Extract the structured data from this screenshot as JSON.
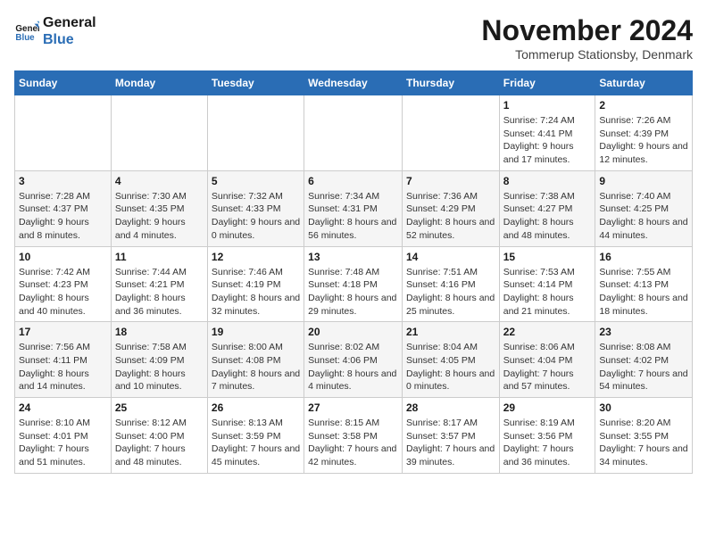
{
  "logo": {
    "line1": "General",
    "line2": "Blue"
  },
  "title": "November 2024",
  "location": "Tommerup Stationsby, Denmark",
  "weekdays": [
    "Sunday",
    "Monday",
    "Tuesday",
    "Wednesday",
    "Thursday",
    "Friday",
    "Saturday"
  ],
  "weeks": [
    [
      {
        "day": "",
        "info": ""
      },
      {
        "day": "",
        "info": ""
      },
      {
        "day": "",
        "info": ""
      },
      {
        "day": "",
        "info": ""
      },
      {
        "day": "",
        "info": ""
      },
      {
        "day": "1",
        "info": "Sunrise: 7:24 AM\nSunset: 4:41 PM\nDaylight: 9 hours and 17 minutes."
      },
      {
        "day": "2",
        "info": "Sunrise: 7:26 AM\nSunset: 4:39 PM\nDaylight: 9 hours and 12 minutes."
      }
    ],
    [
      {
        "day": "3",
        "info": "Sunrise: 7:28 AM\nSunset: 4:37 PM\nDaylight: 9 hours and 8 minutes."
      },
      {
        "day": "4",
        "info": "Sunrise: 7:30 AM\nSunset: 4:35 PM\nDaylight: 9 hours and 4 minutes."
      },
      {
        "day": "5",
        "info": "Sunrise: 7:32 AM\nSunset: 4:33 PM\nDaylight: 9 hours and 0 minutes."
      },
      {
        "day": "6",
        "info": "Sunrise: 7:34 AM\nSunset: 4:31 PM\nDaylight: 8 hours and 56 minutes."
      },
      {
        "day": "7",
        "info": "Sunrise: 7:36 AM\nSunset: 4:29 PM\nDaylight: 8 hours and 52 minutes."
      },
      {
        "day": "8",
        "info": "Sunrise: 7:38 AM\nSunset: 4:27 PM\nDaylight: 8 hours and 48 minutes."
      },
      {
        "day": "9",
        "info": "Sunrise: 7:40 AM\nSunset: 4:25 PM\nDaylight: 8 hours and 44 minutes."
      }
    ],
    [
      {
        "day": "10",
        "info": "Sunrise: 7:42 AM\nSunset: 4:23 PM\nDaylight: 8 hours and 40 minutes."
      },
      {
        "day": "11",
        "info": "Sunrise: 7:44 AM\nSunset: 4:21 PM\nDaylight: 8 hours and 36 minutes."
      },
      {
        "day": "12",
        "info": "Sunrise: 7:46 AM\nSunset: 4:19 PM\nDaylight: 8 hours and 32 minutes."
      },
      {
        "day": "13",
        "info": "Sunrise: 7:48 AM\nSunset: 4:18 PM\nDaylight: 8 hours and 29 minutes."
      },
      {
        "day": "14",
        "info": "Sunrise: 7:51 AM\nSunset: 4:16 PM\nDaylight: 8 hours and 25 minutes."
      },
      {
        "day": "15",
        "info": "Sunrise: 7:53 AM\nSunset: 4:14 PM\nDaylight: 8 hours and 21 minutes."
      },
      {
        "day": "16",
        "info": "Sunrise: 7:55 AM\nSunset: 4:13 PM\nDaylight: 8 hours and 18 minutes."
      }
    ],
    [
      {
        "day": "17",
        "info": "Sunrise: 7:56 AM\nSunset: 4:11 PM\nDaylight: 8 hours and 14 minutes."
      },
      {
        "day": "18",
        "info": "Sunrise: 7:58 AM\nSunset: 4:09 PM\nDaylight: 8 hours and 10 minutes."
      },
      {
        "day": "19",
        "info": "Sunrise: 8:00 AM\nSunset: 4:08 PM\nDaylight: 8 hours and 7 minutes."
      },
      {
        "day": "20",
        "info": "Sunrise: 8:02 AM\nSunset: 4:06 PM\nDaylight: 8 hours and 4 minutes."
      },
      {
        "day": "21",
        "info": "Sunrise: 8:04 AM\nSunset: 4:05 PM\nDaylight: 8 hours and 0 minutes."
      },
      {
        "day": "22",
        "info": "Sunrise: 8:06 AM\nSunset: 4:04 PM\nDaylight: 7 hours and 57 minutes."
      },
      {
        "day": "23",
        "info": "Sunrise: 8:08 AM\nSunset: 4:02 PM\nDaylight: 7 hours and 54 minutes."
      }
    ],
    [
      {
        "day": "24",
        "info": "Sunrise: 8:10 AM\nSunset: 4:01 PM\nDaylight: 7 hours and 51 minutes."
      },
      {
        "day": "25",
        "info": "Sunrise: 8:12 AM\nSunset: 4:00 PM\nDaylight: 7 hours and 48 minutes."
      },
      {
        "day": "26",
        "info": "Sunrise: 8:13 AM\nSunset: 3:59 PM\nDaylight: 7 hours and 45 minutes."
      },
      {
        "day": "27",
        "info": "Sunrise: 8:15 AM\nSunset: 3:58 PM\nDaylight: 7 hours and 42 minutes."
      },
      {
        "day": "28",
        "info": "Sunrise: 8:17 AM\nSunset: 3:57 PM\nDaylight: 7 hours and 39 minutes."
      },
      {
        "day": "29",
        "info": "Sunrise: 8:19 AM\nSunset: 3:56 PM\nDaylight: 7 hours and 36 minutes."
      },
      {
        "day": "30",
        "info": "Sunrise: 8:20 AM\nSunset: 3:55 PM\nDaylight: 7 hours and 34 minutes."
      }
    ]
  ]
}
